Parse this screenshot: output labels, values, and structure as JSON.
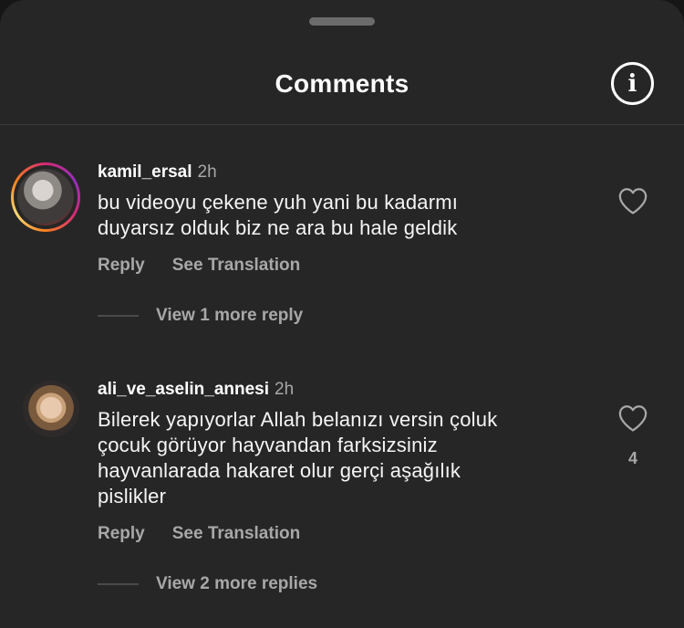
{
  "header": {
    "title": "Comments",
    "info_icon": "info-icon"
  },
  "comments": [
    {
      "username": "kamil_ersal",
      "time": "2h",
      "text_lines": [
        "bu videoyu çekene yuh yani bu kadarmı",
        "duyarsız olduk biz ne ara bu hale geldik"
      ],
      "reply_label": "Reply",
      "translate_label": "See Translation",
      "view_more": "View 1 more reply",
      "likes": "",
      "story_ring": true
    },
    {
      "username": "ali_ve_aselin_annesi",
      "time": "2h",
      "text_lines": [
        "Bilerek yapıyorlar Allah belanızı versin çoluk",
        "çocuk görüyor hayvandan farksizsiniz",
        "hayvanlarada hakaret olur gerçi aşağılık",
        "pislikler"
      ],
      "reply_label": "Reply",
      "translate_label": "See Translation",
      "view_more": "View 2 more replies",
      "likes": "4",
      "story_ring": false
    }
  ],
  "colors": {
    "background": "#262626",
    "muted": "#a8a8a8",
    "story_ring": [
      "#feda75",
      "#fa7e1e",
      "#d62976",
      "#962fbf"
    ]
  }
}
